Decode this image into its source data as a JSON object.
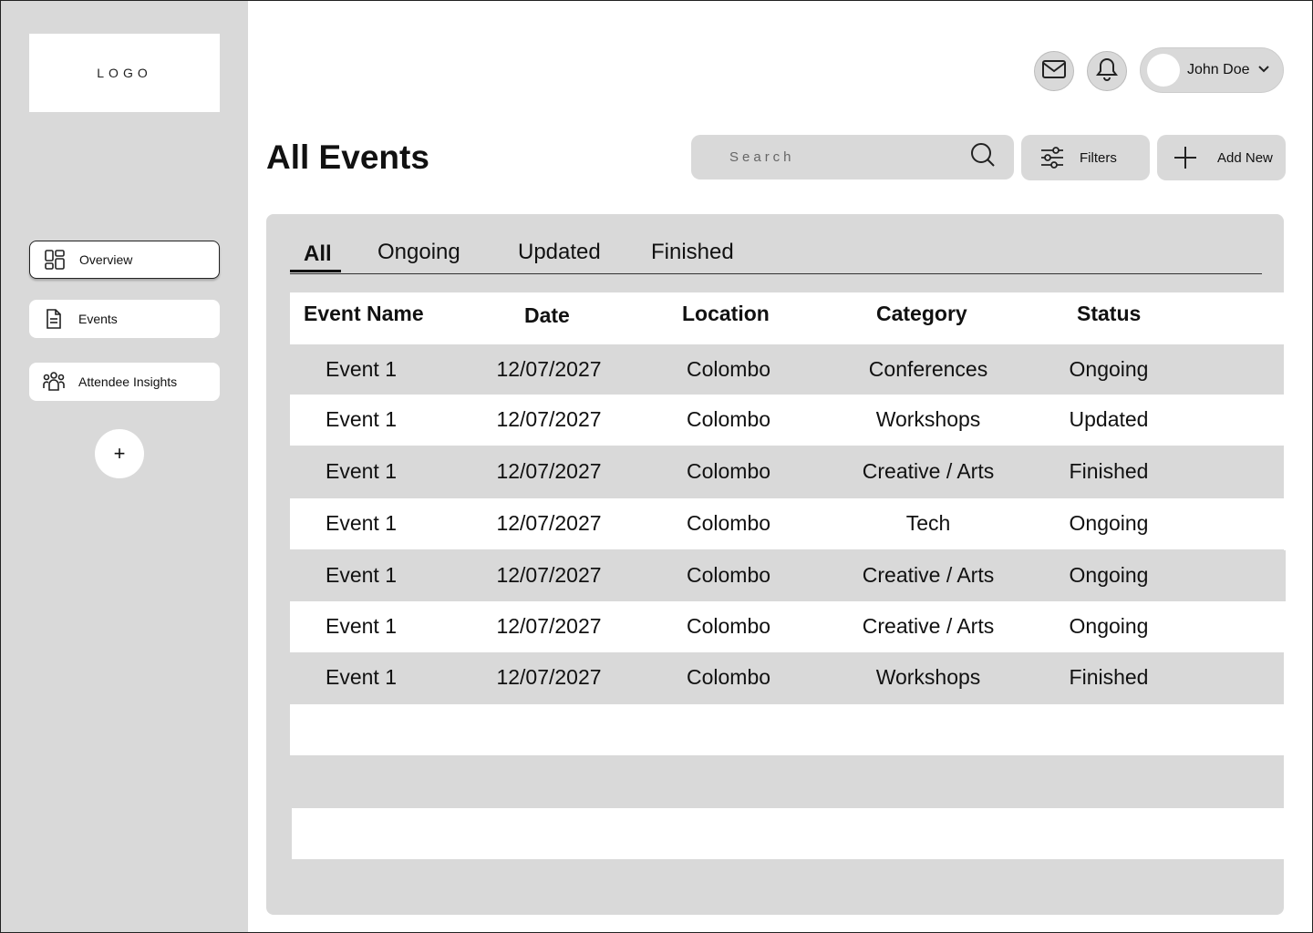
{
  "logo": {
    "text": "LOGO"
  },
  "sidebar": {
    "items": [
      {
        "label": "Overview",
        "icon": "dashboard-icon",
        "active": true
      },
      {
        "label": "Events",
        "icon": "document-icon",
        "active": false
      },
      {
        "label": "Attendee Insights",
        "icon": "users-group-icon",
        "active": false
      }
    ],
    "add_label": "+"
  },
  "header": {
    "mail_icon": "mail-icon",
    "bell_icon": "bell-icon",
    "user_name": "John Doe"
  },
  "page": {
    "title": "All Events",
    "search_placeholder": "Search",
    "filters_label": "Filters",
    "add_new_label": "Add New"
  },
  "tabs": [
    {
      "label": "All",
      "active": true
    },
    {
      "label": "Ongoing",
      "active": false
    },
    {
      "label": "Updated",
      "active": false
    },
    {
      "label": "Finished",
      "active": false
    }
  ],
  "table": {
    "columns": [
      "Event Name",
      "Date",
      "Location",
      "Category",
      "Status"
    ],
    "rows": [
      [
        "Event 1",
        "12/07/2027",
        "Colombo",
        "Conferences",
        "Ongoing"
      ],
      [
        "Event 1",
        "12/07/2027",
        "Colombo",
        "Workshops",
        "Updated"
      ],
      [
        "Event 1",
        "12/07/2027",
        "Colombo",
        "Creative / Arts",
        "Finished"
      ],
      [
        "Event 1",
        "12/07/2027",
        "Colombo",
        "Tech",
        "Ongoing"
      ],
      [
        "Event 1",
        "12/07/2027",
        "Colombo",
        "Creative / Arts",
        "Ongoing"
      ],
      [
        "Event 1",
        "12/07/2027",
        "Colombo",
        "Creative / Arts",
        "Ongoing"
      ],
      [
        "Event 1",
        "12/07/2027",
        "Colombo",
        "Workshops",
        "Finished"
      ]
    ]
  },
  "colors": {
    "sidebar_bg": "#d9d9d9",
    "panel_bg": "#d9d9d9",
    "row_alt": "#d9d9d9",
    "row_base": "#ffffff"
  }
}
